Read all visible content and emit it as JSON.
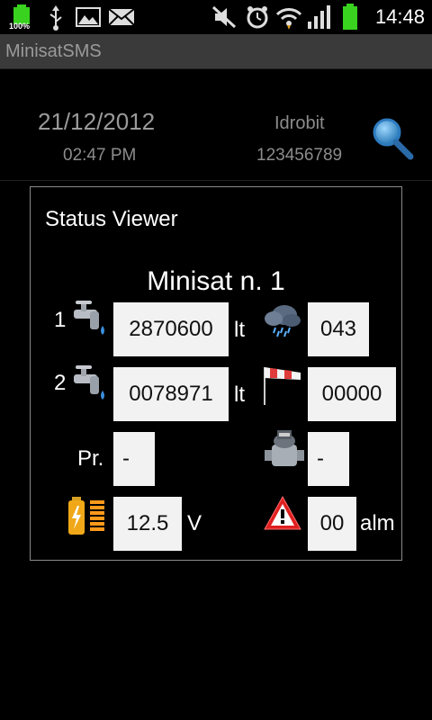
{
  "status_bar": {
    "battery_percent_label": "100%",
    "time": "14:48"
  },
  "app": {
    "title": "MinisatSMS"
  },
  "header": {
    "date": "21/12/2012",
    "time": "02:47 PM",
    "name": "Idrobit",
    "phone": "123456789"
  },
  "panel": {
    "title": "Status Viewer",
    "minisat_title": "Minisat n. 1",
    "rows": {
      "meter1": {
        "index": "1",
        "value": "2870600",
        "unit": "lt"
      },
      "rain": {
        "value": "043"
      },
      "meter2": {
        "index": "2",
        "value": "0078971",
        "unit": "lt"
      },
      "wind": {
        "value": "00000"
      },
      "pressure": {
        "label": "Pr.",
        "value": "-"
      },
      "valve": {
        "value": "-"
      },
      "battery": {
        "value": "12.5",
        "unit": "V"
      },
      "alarm": {
        "value": "00",
        "unit": "alm"
      }
    }
  },
  "icons": [
    "sd-battery-icon",
    "usb-icon",
    "image-icon",
    "mail-icon",
    "mute-icon",
    "alarm-clock-icon",
    "wifi-icon",
    "signal-icon",
    "battery-icon",
    "search-icon",
    "faucet-icon",
    "rain-cloud-icon",
    "windsock-icon",
    "water-meter-icon",
    "battery-level-icon",
    "warning-icon"
  ],
  "colors": {
    "accent_green": "#39d21f",
    "title_bar": "#3a3a3a"
  }
}
